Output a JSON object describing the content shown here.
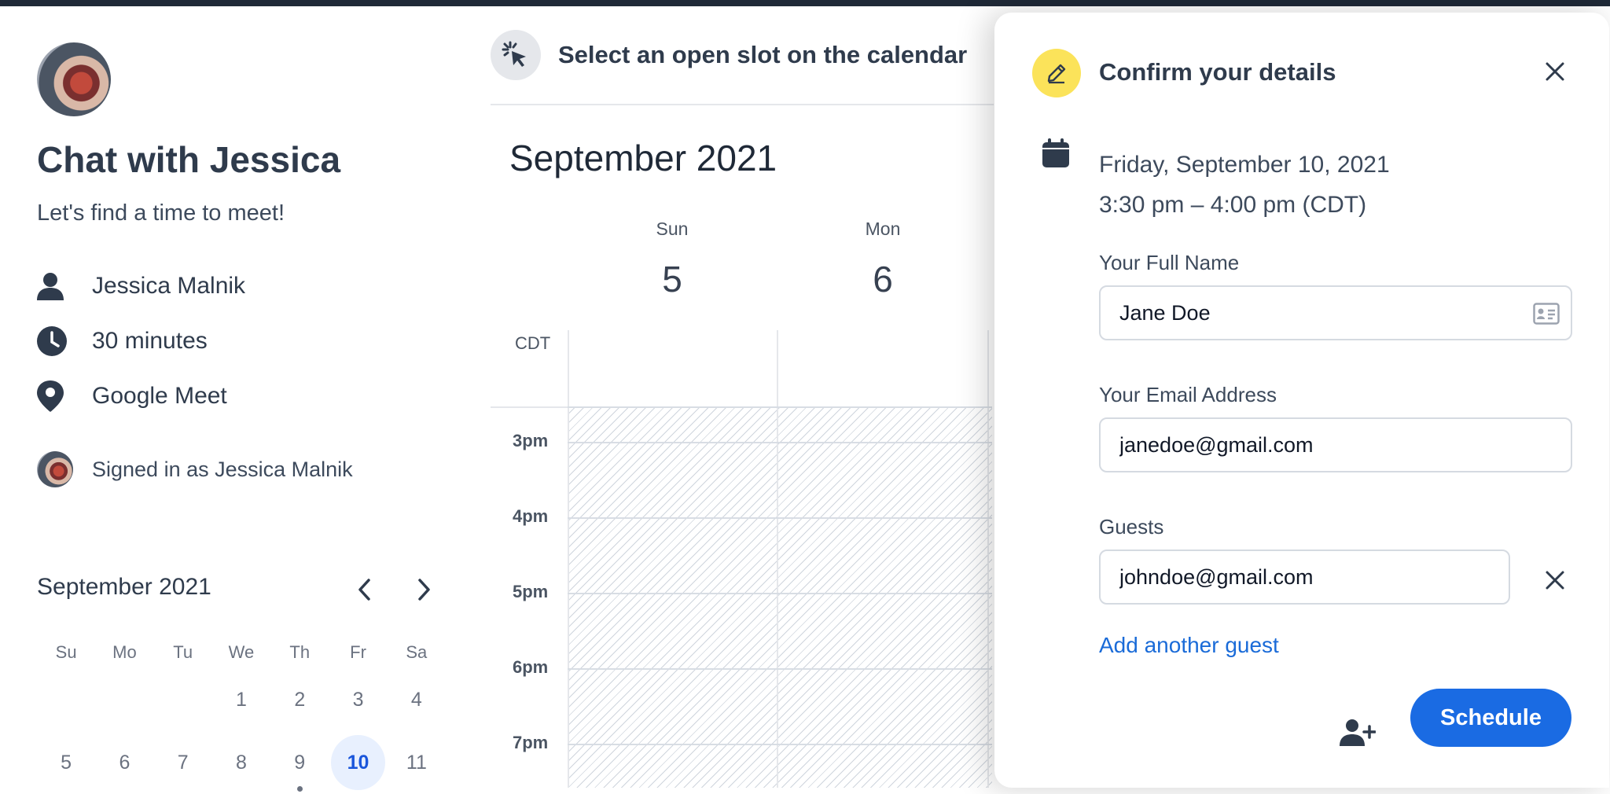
{
  "sidebar": {
    "title": "Chat with Jessica",
    "subtitle": "Let's find a time to meet!",
    "host_name": "Jessica Malnik",
    "duration": "30 minutes",
    "location": "Google Meet",
    "signed_in": "Signed in as Jessica Malnik",
    "icons": {
      "host": "person-icon",
      "duration": "clock-icon",
      "location": "map-pin-icon"
    }
  },
  "mini_calendar": {
    "month": "September 2021",
    "weekdays": [
      "Su",
      "Mo",
      "Tu",
      "We",
      "Th",
      "Fr",
      "Sa"
    ],
    "row1": [
      "",
      "",
      "",
      "1",
      "2",
      "3",
      "4"
    ],
    "row2": [
      "5",
      "6",
      "7",
      "8",
      "9",
      "10",
      "11"
    ],
    "selected": "10"
  },
  "calendar": {
    "hint": "Select an open slot on the calendar",
    "month": "September 2021",
    "days": [
      {
        "name": "Sun",
        "num": "5"
      },
      {
        "name": "Mon",
        "num": "6"
      }
    ],
    "timezone": "CDT",
    "hours": [
      "3pm",
      "4pm",
      "5pm",
      "6pm",
      "7pm"
    ]
  },
  "modal": {
    "title": "Confirm your details",
    "date": "Friday, September 10, 2021",
    "time": "3:30 pm – 4:00 pm (CDT)",
    "name_label": "Your Full Name",
    "name_value": "Jane Doe",
    "email_label": "Your Email Address",
    "email_value": "janedoe@gmail.com",
    "guests_label": "Guests",
    "guest_value": "johndoe@gmail.com",
    "add_guest": "Add another guest",
    "schedule": "Schedule"
  },
  "colors": {
    "accent": "#1a6be3",
    "badge": "#fbe35a",
    "link": "#1a6bd8",
    "selected_bg": "#e8f0fe"
  }
}
